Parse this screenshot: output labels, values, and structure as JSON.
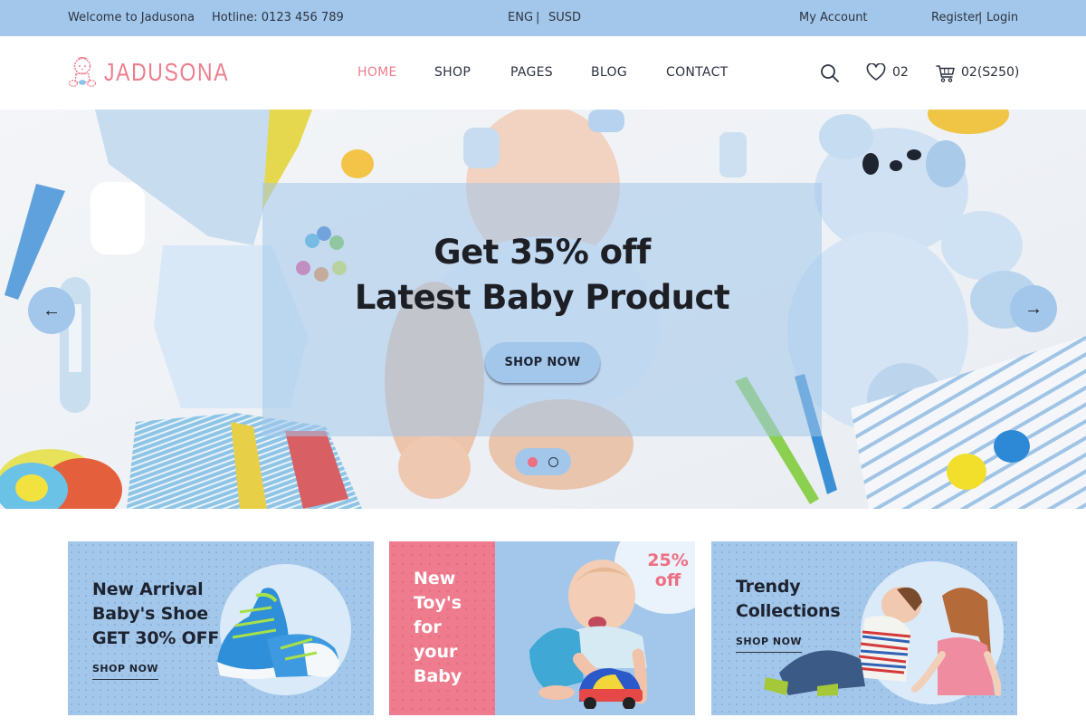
{
  "topbar": {
    "welcome": "Welcome to Jadusona",
    "hotline": "Hotline: 0123 456 789",
    "language": "ENG",
    "separator": "|",
    "currency": "SUSD",
    "my_account": "My Account",
    "register": "Register",
    "login": "Login"
  },
  "header": {
    "logo_text": "JADUSONA",
    "nav": [
      {
        "label": "HOME",
        "active": true
      },
      {
        "label": "SHOP",
        "active": false
      },
      {
        "label": "PAGES",
        "active": false
      },
      {
        "label": "BLOG",
        "active": false
      },
      {
        "label": "CONTACT",
        "active": false
      }
    ],
    "wishlist_count": "02",
    "cart_summary": "02(S250)"
  },
  "hero": {
    "title_line1": "Get 35% off",
    "title_line2": "Latest Baby Product",
    "button_label": "SHOP NOW",
    "prev_arrow": "←",
    "next_arrow": "→",
    "slides_total": 2,
    "active_slide": 1
  },
  "banners": [
    {
      "lines": [
        "New Arrival",
        "Baby's Shoe",
        "GET 30% OFF"
      ],
      "link_label": "SHOP NOW"
    },
    {
      "lines": [
        "New",
        "Toy's",
        "for",
        "your",
        "Baby"
      ],
      "badge_line1": "25%",
      "badge_line2": "off"
    },
    {
      "lines": [
        "Trendy",
        "Collections"
      ],
      "link_label": "SHOP NOW"
    }
  ],
  "colors": {
    "primary_blue": "#a3c7ea",
    "accent_pink": "#ec7e8e",
    "text_dark": "#1d2330"
  }
}
